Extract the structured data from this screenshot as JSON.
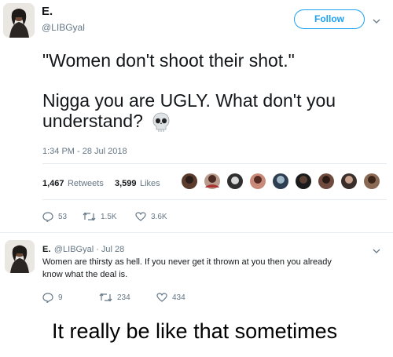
{
  "tweet": {
    "display_name": "E.",
    "handle": "@LIBGyal",
    "follow_label": "Follow",
    "line1": "\"Women don't shoot their shot.\"",
    "line2a": "Nigga you are UGLY. What don't you",
    "line2b": "understand?",
    "emoji_icon": "skull-icon",
    "timestamp": "1:34 PM - 28 Jul 2018",
    "retweets_count": "1,467",
    "retweets_label": "Retweets",
    "likes_count": "3,599",
    "likes_label": "Likes",
    "actions": {
      "replies": "53",
      "retweets": "1.5K",
      "likes": "3.6K"
    }
  },
  "reply": {
    "display_name": "E.",
    "handle_date": "@LIBGyal · Jul 28",
    "text_line1": "Women are thirsty as hell. If you never get it thrown at you then you already",
    "text_line2": "know what the deal is.",
    "actions": {
      "replies": "9",
      "retweets": "234",
      "likes": "434"
    }
  },
  "caption": "It really be like that sometimes",
  "colors": {
    "accent": "#1da1f2",
    "muted": "#657786",
    "text": "#14171a",
    "divider": "#e6ecf0"
  }
}
